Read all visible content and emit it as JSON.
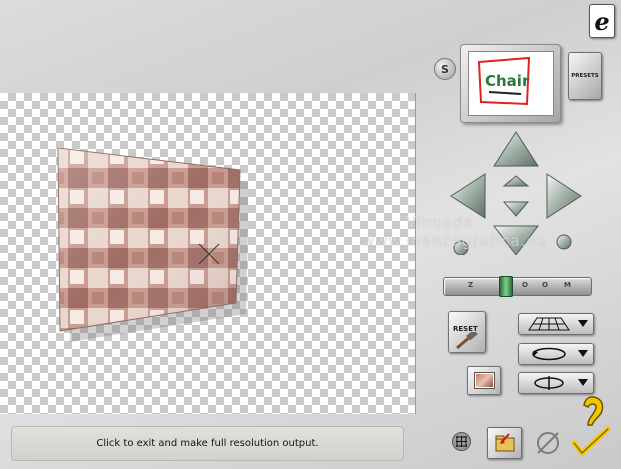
{
  "window": {
    "logo_glyph": "e"
  },
  "toolbar": {
    "s_label": "S",
    "presets_label": "PRESETS"
  },
  "preview": {
    "text": "Chair"
  },
  "zoom": {
    "labels": [
      "Z",
      "O",
      "O",
      "M"
    ]
  },
  "buttons": {
    "reset_label": "RESET"
  },
  "status": {
    "message": "Click to exit and make full resolution output."
  },
  "watermark": {
    "line1": "Vinoeda",
    "line2": "www.mancegrafica.eu"
  },
  "colors": {
    "ok_check": "#f2c600",
    "nav_metal": "#9fb0a6"
  }
}
